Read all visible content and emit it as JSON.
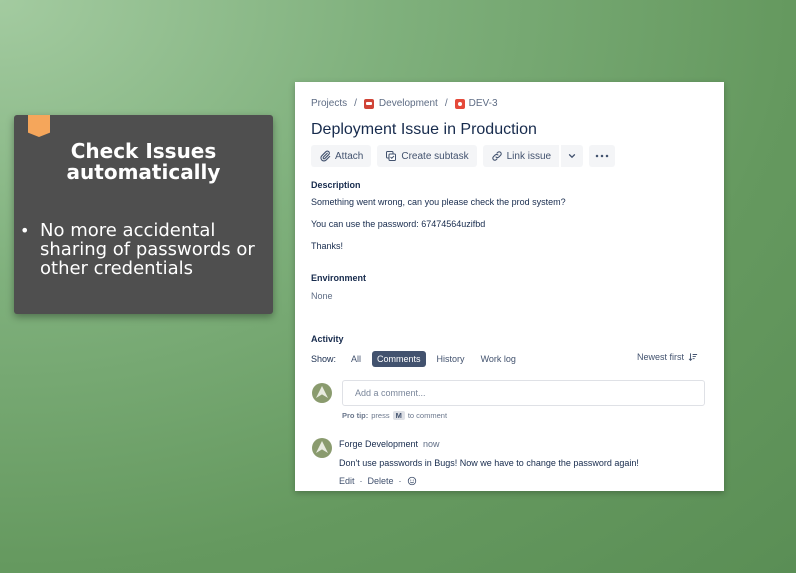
{
  "callout": {
    "title_line1": "Check Issues",
    "title_line2": "automatically",
    "bullet": "No more accidental sharing of passwords or other credentials"
  },
  "breadcrumb": {
    "projects": "Projects",
    "project": "Development",
    "issue_key": "DEV-3"
  },
  "issue": {
    "title": "Deployment Issue in Production"
  },
  "toolbar": {
    "attach": "Attach",
    "create_subtask": "Create subtask",
    "link_issue": "Link issue"
  },
  "description": {
    "label": "Description",
    "line1": "Something went wrong, can you please check the prod system?",
    "line2": "You can use the password: 67474564uzifbd",
    "line3": "Thanks!"
  },
  "environment": {
    "label": "Environment",
    "value": "None"
  },
  "activity": {
    "label": "Activity",
    "show_label": "Show:",
    "filters": [
      "All",
      "Comments",
      "History",
      "Work log"
    ],
    "active_filter": "Comments",
    "sort": "Newest first"
  },
  "comment_input": {
    "placeholder": "Add a comment...",
    "protip_bold": "Pro tip:",
    "protip_press": "press",
    "protip_key": "M",
    "protip_rest": "to comment"
  },
  "comment": {
    "author": "Forge Development",
    "time": "now",
    "text": "Don't use passwords in Bugs! Now we have to change the password again!",
    "edit": "Edit",
    "delete": "Delete"
  },
  "colors": {
    "background": "#7fb07c",
    "callout_bg": "#4f4f4f",
    "bookmark": "#f5a65b",
    "text_primary": "#172b4d",
    "active_filter": "#42526e"
  }
}
